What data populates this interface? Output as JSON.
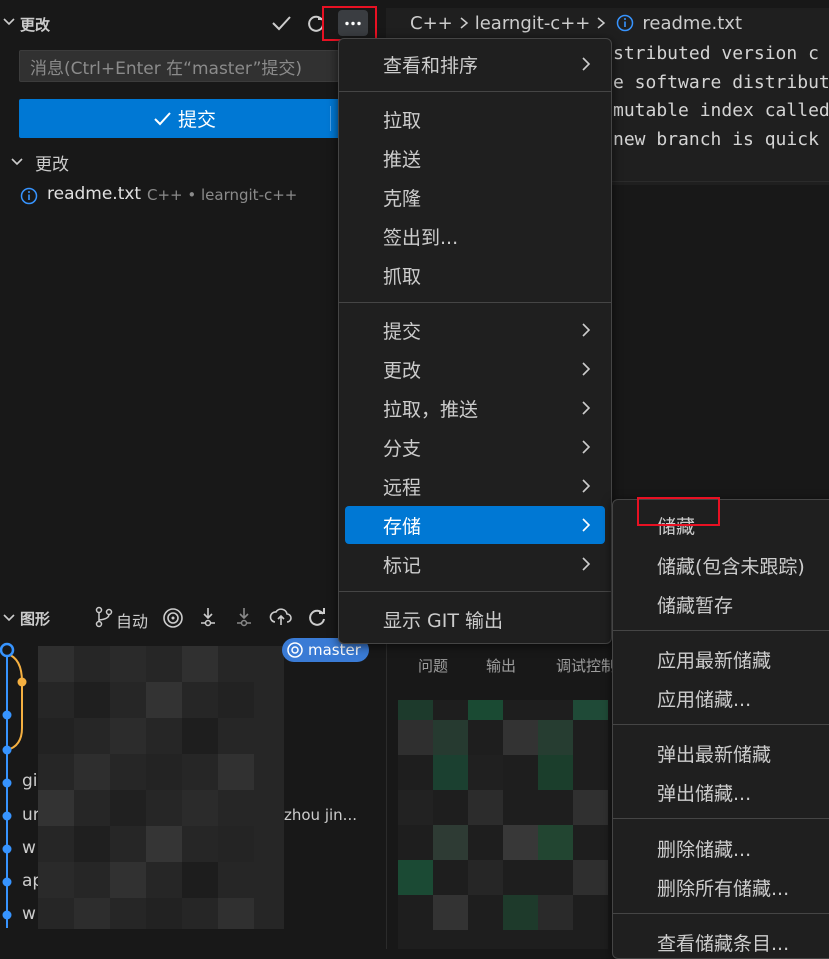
{
  "scm": {
    "section_title": "更改",
    "message_placeholder": "消息(Ctrl+Enter 在“master”提交)",
    "commit_label": "提交",
    "changes_group_label": "更改",
    "file_name": "readme.txt",
    "file_path": "C++ • learngit-c++"
  },
  "graph": {
    "title": "图形",
    "auto_label": "自动",
    "branch_badge": "master",
    "row_labels": [
      "gi",
      "ur",
      "w",
      "ap",
      "w"
    ],
    "partial_text": "zhou jin..."
  },
  "editor": {
    "breadcrumb": [
      "C++",
      "learngit-c++",
      "readme.txt"
    ],
    "code_lines": [
      "stributed version c",
      "e software distribut",
      "mutable index called",
      " new branch is quick"
    ]
  },
  "panel": {
    "tabs": [
      "问题",
      "输出",
      "调试控制"
    ]
  },
  "menu": {
    "items": [
      {
        "label": "查看和排序",
        "submenu": true
      },
      {
        "label": "拉取",
        "submenu": false
      },
      {
        "label": "推送",
        "submenu": false
      },
      {
        "label": "克隆",
        "submenu": false
      },
      {
        "label": "签出到...",
        "submenu": false
      },
      {
        "label": "抓取",
        "submenu": false
      },
      {
        "label": "提交",
        "submenu": true
      },
      {
        "label": "更改",
        "submenu": true
      },
      {
        "label": "拉取，推送",
        "submenu": true
      },
      {
        "label": "分支",
        "submenu": true
      },
      {
        "label": "远程",
        "submenu": true
      },
      {
        "label": "存储",
        "submenu": true
      },
      {
        "label": "标记",
        "submenu": true
      },
      {
        "label": "显示 GIT 输出",
        "submenu": false
      }
    ]
  },
  "stash_menu": {
    "items": [
      "储藏",
      "储藏(包含未跟踪)",
      "储藏暂存",
      "应用最新储藏",
      "应用储藏...",
      "弹出最新储藏",
      "弹出储藏...",
      "删除储藏...",
      "删除所有储藏...",
      "查看储藏条目..."
    ]
  },
  "colors": {
    "accent": "#0078d4",
    "highlight_box": "#e81123",
    "graph_line": "#3794ff",
    "graph_curve": "#f5b041"
  }
}
